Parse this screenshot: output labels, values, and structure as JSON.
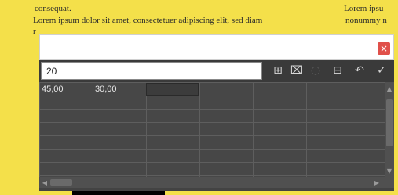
{
  "document": {
    "line1_left": "consequat.",
    "line1_right": "Lorem ipsu",
    "line2_left": "Lorem ipsum dolor sit amet, consectetuer adipiscing elit, sed diam",
    "line2_right": "nonummy n",
    "line3_left": "r"
  },
  "dialog": {
    "close_glyph": "×"
  },
  "toolbar": {
    "formula_value": "20",
    "icons": [
      "insert-table-icon",
      "table-properties-icon",
      "cancel-circle-icon",
      "table-grid-icon",
      "undo-icon",
      "confirm-check-icon"
    ],
    "glyphs": {
      "insert": "⊞",
      "properties": "⌧",
      "cancel": "◌",
      "grid": "⊟",
      "undo": "↶",
      "check": "✓"
    }
  },
  "grid": {
    "cells": [
      "45,00",
      "30,00",
      ""
    ]
  },
  "scroll": {
    "up": "▲",
    "down": "▼",
    "left": "◀",
    "right": "▶"
  }
}
